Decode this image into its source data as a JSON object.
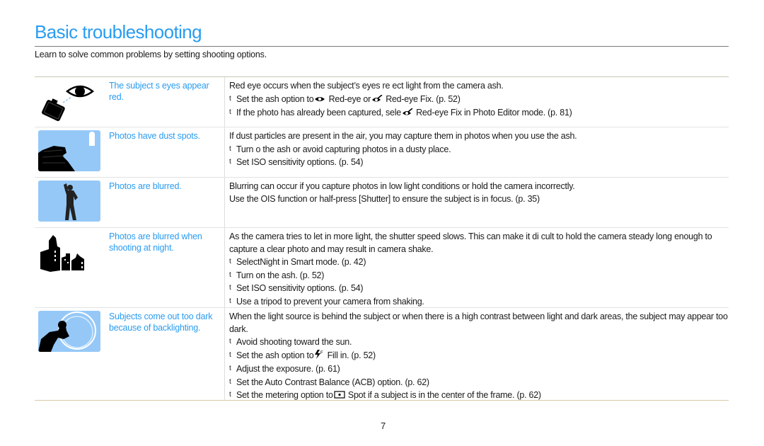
{
  "page": {
    "title": "Basic troubleshooting",
    "subtitle": "Learn to solve common problems by setting shooting options.",
    "page_number": "7",
    "accent_color": "#2a9cf0"
  },
  "rows": [
    {
      "icon": "red-eye-camera-illustration",
      "problem": "The subject s eyes appear red.",
      "intro": "Red eye occurs when the subject’s eyes re ect light from the camera  ash.",
      "bullets": [
        {
          "pre": "Set the  ash option to",
          "icon1": "red-eye-icon",
          "mid": " Red-eye or",
          "icon2": "red-eye-fix-icon",
          "post": " Red-eye Fix. (p. 52)"
        },
        {
          "pre": "If the photo has already been captured, sele",
          "icon1": "red-eye-fix-icon",
          "post": " Red-eye Fix in Photo Editor mode. (p. 81)"
        }
      ]
    },
    {
      "icon": "dust-spots-illustration",
      "problem": "Photos have dust spots.",
      "intro": "If dust particles are present in the air, you may capture them in photos when you use the  ash.",
      "bullets": [
        {
          "text": "Turn o  the  ash or avoid capturing photos in a dusty place."
        },
        {
          "text": "Set ISO sensitivity options. (p. 54)"
        }
      ]
    },
    {
      "icon": "blurred-person-illustration",
      "problem": "Photos are blurred.",
      "intro": "Blurring can occur if you capture photos in low light conditions or hold the camera incorrectly.",
      "intro2": "Use the OIS function or half-press [Shutter] to ensure the subject is in focus. (p. 35)",
      "bullets": []
    },
    {
      "icon": "night-city-illustration",
      "problem": "Photos are blurred when shooting at night.",
      "intro": "As the camera tries to let in more light, the shutter speed slows. This can make it di cult to hold the camera steady long enough to capture a clear photo and may result in camera shake.",
      "bullets": [
        {
          "text": "SelectNight in Smart mode. (p. 42)"
        },
        {
          "text": "Turn on the  ash. (p. 52)"
        },
        {
          "text": "Set ISO sensitivity options. (p. 54)"
        },
        {
          "text": "Use a tripod to prevent your camera from shaking."
        }
      ]
    },
    {
      "icon": "backlight-person-illustration",
      "problem": "Subjects come out too dark because of backlighting.",
      "intro": "When the light source is behind the subject or when there is a high contrast between light and dark areas, the subject may appear too dark.",
      "bullets": [
        {
          "text": "Avoid shooting toward the sun."
        },
        {
          "pre": "Set the  ash option to",
          "icon1": "fill-flash-icon",
          "post": " Fill in. (p. 52)"
        },
        {
          "text": "Adjust the exposure. (p. 61)"
        },
        {
          "text": "Set the Auto Contrast Balance (ACB) option. (p. 62)"
        },
        {
          "pre": "Set the metering option to",
          "icon1": "spot-metering-icon",
          "post": " Spot if a subject is in the center of the frame. (p. 62)"
        }
      ]
    }
  ],
  "bullet_mark": "t"
}
